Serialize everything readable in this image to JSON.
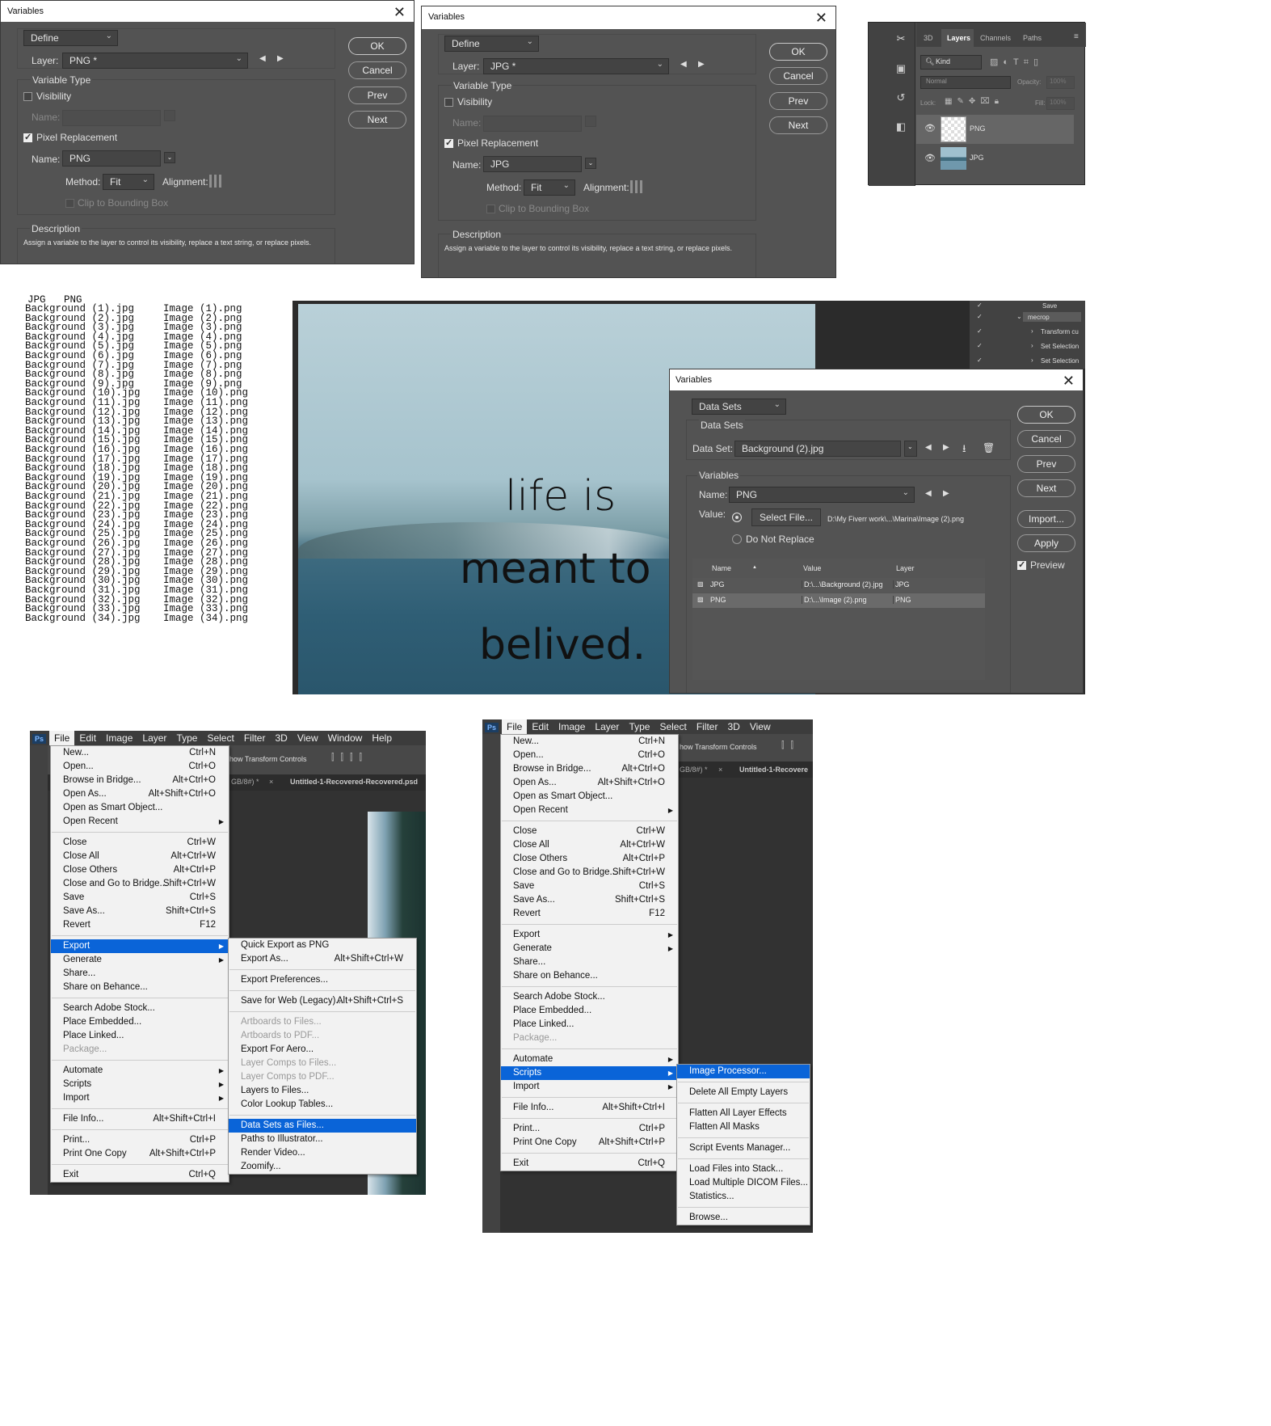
{
  "common": {
    "ok": "OK",
    "cancel": "Cancel",
    "prev": "Prev",
    "next": "Next",
    "variables_title": "Variables",
    "define": "Define",
    "layer_label": "Layer:",
    "variable_type": "Variable Type",
    "visibility": "Visibility",
    "name_label": "Name:",
    "pixel_replacement": "Pixel Replacement",
    "method_label": "Method:",
    "method_value": "Fit",
    "alignment_label": "Alignment:",
    "clip": "Clip to Bounding Box",
    "description_label": "Description",
    "description_text": "Assign a variable to the layer to control its visibility, replace a text string, or replace pixels."
  },
  "dialog1": {
    "layer_value": "PNG *",
    "name_value": "PNG"
  },
  "dialog2": {
    "layer_value": "JPG *",
    "name_value": "JPG"
  },
  "layers_panel": {
    "tabs": [
      "3D",
      "Layers",
      "Channels",
      "Paths"
    ],
    "kind": "Kind",
    "blend": "Normal",
    "opacity_label": "Opacity:",
    "opacity_value": "100%",
    "lock_label": "Lock:",
    "fill_label": "Fill:",
    "fill_value": "100%",
    "layers": [
      "PNG",
      "JPG"
    ]
  },
  "csv": {
    "header": "JPG   PNG",
    "rows": [
      [
        "Background (1).jpg",
        "Image (1).png"
      ],
      [
        "Background (2).jpg",
        "Image (2).png"
      ],
      [
        "Background (3).jpg",
        "Image (3).png"
      ],
      [
        "Background (4).jpg",
        "Image (4).png"
      ],
      [
        "Background (5).jpg",
        "Image (5).png"
      ],
      [
        "Background (6).jpg",
        "Image (6).png"
      ],
      [
        "Background (7).jpg",
        "Image (7).png"
      ],
      [
        "Background (8).jpg",
        "Image (8).png"
      ],
      [
        "Background (9).jpg",
        "Image (9).png"
      ],
      [
        "Background (10).jpg",
        "Image (10).png"
      ],
      [
        "Background (11).jpg",
        "Image (11).png"
      ],
      [
        "Background (12).jpg",
        "Image (12).png"
      ],
      [
        "Background (13).jpg",
        "Image (13).png"
      ],
      [
        "Background (14).jpg",
        "Image (14).png"
      ],
      [
        "Background (15).jpg",
        "Image (15).png"
      ],
      [
        "Background (16).jpg",
        "Image (16).png"
      ],
      [
        "Background (17).jpg",
        "Image (17).png"
      ],
      [
        "Background (18).jpg",
        "Image (18).png"
      ],
      [
        "Background (19).jpg",
        "Image (19).png"
      ],
      [
        "Background (20).jpg",
        "Image (20).png"
      ],
      [
        "Background (21).jpg",
        "Image (21).png"
      ],
      [
        "Background (22).jpg",
        "Image (22).png"
      ],
      [
        "Background (23).jpg",
        "Image (23).png"
      ],
      [
        "Background (24).jpg",
        "Image (24).png"
      ],
      [
        "Background (25).jpg",
        "Image (25).png"
      ],
      [
        "Background (26).jpg",
        "Image (26).png"
      ],
      [
        "Background (27).jpg",
        "Image (27).png"
      ],
      [
        "Background (28).jpg",
        "Image (28).png"
      ],
      [
        "Background (29).jpg",
        "Image (29).png"
      ],
      [
        "Background (30).jpg",
        "Image (30).png"
      ],
      [
        "Background (31).jpg",
        "Image (31).png"
      ],
      [
        "Background (32).jpg",
        "Image (32).png"
      ],
      [
        "Background (33).jpg",
        "Image (33).png"
      ],
      [
        "Background (34).jpg",
        "Image (34).png"
      ]
    ]
  },
  "canvas_text": {
    "line1": "life is",
    "line2": "meant to",
    "line3": "belived."
  },
  "actions": {
    "items": [
      "Save",
      "mecrop",
      "Transform cu",
      "Set Selection",
      "Set Selection"
    ]
  },
  "datasets_dialog": {
    "mode": "Data Sets",
    "group_label": "Data Sets",
    "dataset_label": "Data Set:",
    "dataset_value": "Background (2).jpg",
    "variables_group": "Variables",
    "name_label": "Name:",
    "name_value": "PNG",
    "value_label": "Value:",
    "select_file": "Select File...",
    "path": "D:\\My Fiverr work\\...\\Marina\\Image (2).png",
    "do_not_replace": "Do Not Replace",
    "col_name": "Name",
    "col_value": "Value",
    "col_layer": "Layer",
    "rows": [
      {
        "name": "JPG",
        "value": "D:\\...\\Background (2).jpg",
        "layer": "JPG"
      },
      {
        "name": "PNG",
        "value": "D:\\...\\Image (2).png",
        "layer": "PNG"
      }
    ],
    "import": "Import...",
    "apply": "Apply",
    "preview": "Preview"
  },
  "menubar": [
    "Ps",
    "File",
    "Edit",
    "Image",
    "Layer",
    "Type",
    "Select",
    "Filter",
    "3D",
    "View",
    "Window",
    "Help"
  ],
  "options_bar_text": "how Transform Controls",
  "doc_tab1": "GB/8#) *",
  "doc_tab2": "Untitled-1-Recovered-Recovered.psd",
  "doc_tab2_short": "Untitled-1-Recovere",
  "file_menu": {
    "g1": [
      [
        "New...",
        "Ctrl+N"
      ],
      [
        "Open...",
        "Ctrl+O"
      ],
      [
        "Browse in Bridge...",
        "Alt+Ctrl+O"
      ],
      [
        "Open As...",
        "Alt+Shift+Ctrl+O"
      ],
      [
        "Open as Smart Object...",
        ""
      ],
      [
        "Open Recent",
        ""
      ]
    ],
    "g2": [
      [
        "Close",
        "Ctrl+W"
      ],
      [
        "Close All",
        "Alt+Ctrl+W"
      ],
      [
        "Close Others",
        "Alt+Ctrl+P"
      ],
      [
        "Close and Go to Bridge...",
        "Shift+Ctrl+W"
      ],
      [
        "Save",
        "Ctrl+S"
      ],
      [
        "Save As...",
        "Shift+Ctrl+S"
      ],
      [
        "Revert",
        "F12"
      ]
    ],
    "g3": [
      [
        "Export",
        ""
      ],
      [
        "Generate",
        ""
      ],
      [
        "Share...",
        ""
      ],
      [
        "Share on Behance...",
        ""
      ]
    ],
    "g4": [
      [
        "Search Adobe Stock...",
        ""
      ],
      [
        "Place Embedded...",
        ""
      ],
      [
        "Place Linked...",
        ""
      ],
      [
        "Package...",
        ""
      ]
    ],
    "g5": [
      [
        "Automate",
        ""
      ],
      [
        "Scripts",
        ""
      ],
      [
        "Import",
        ""
      ]
    ],
    "g6": [
      [
        "File Info...",
        "Alt+Shift+Ctrl+I"
      ]
    ],
    "g7": [
      [
        "Print...",
        "Ctrl+P"
      ],
      [
        "Print One Copy",
        "Alt+Shift+Ctrl+P"
      ]
    ],
    "g8": [
      [
        "Exit",
        "Ctrl+Q"
      ]
    ]
  },
  "export_menu": {
    "g1": [
      [
        "Quick Export as PNG",
        ""
      ],
      [
        "Export As...",
        "Alt+Shift+Ctrl+W"
      ]
    ],
    "g2": [
      [
        "Export Preferences...",
        ""
      ]
    ],
    "g3": [
      [
        "Save for Web (Legacy)...",
        "Alt+Shift+Ctrl+S"
      ]
    ],
    "g4": [
      [
        "Artboards to Files...",
        ""
      ],
      [
        "Artboards to PDF...",
        ""
      ],
      [
        "Export For Aero...",
        ""
      ],
      [
        "Layer Comps to Files...",
        ""
      ],
      [
        "Layer Comps to PDF...",
        ""
      ],
      [
        "Layers to Files...",
        ""
      ],
      [
        "Color Lookup Tables...",
        ""
      ]
    ],
    "g5": [
      [
        "Data Sets as Files...",
        ""
      ],
      [
        "Paths to Illustrator...",
        ""
      ],
      [
        "Render Video...",
        ""
      ],
      [
        "Zoomify...",
        ""
      ]
    ]
  },
  "scripts_menu": {
    "g1": [
      [
        "Image Processor...",
        ""
      ]
    ],
    "g2": [
      [
        "Delete All Empty Layers",
        ""
      ]
    ],
    "g3": [
      [
        "Flatten All Layer Effects",
        ""
      ],
      [
        "Flatten All Masks",
        ""
      ]
    ],
    "g4": [
      [
        "Script Events Manager...",
        ""
      ]
    ],
    "g5": [
      [
        "Load Files into Stack...",
        ""
      ],
      [
        "Load Multiple DICOM Files...",
        ""
      ],
      [
        "Statistics...",
        ""
      ]
    ],
    "g6": [
      [
        "Browse...",
        ""
      ]
    ]
  },
  "colors": {
    "dialog_bg": "#535353",
    "highlight": "#0a64d8",
    "ps_dark": "#323232"
  }
}
